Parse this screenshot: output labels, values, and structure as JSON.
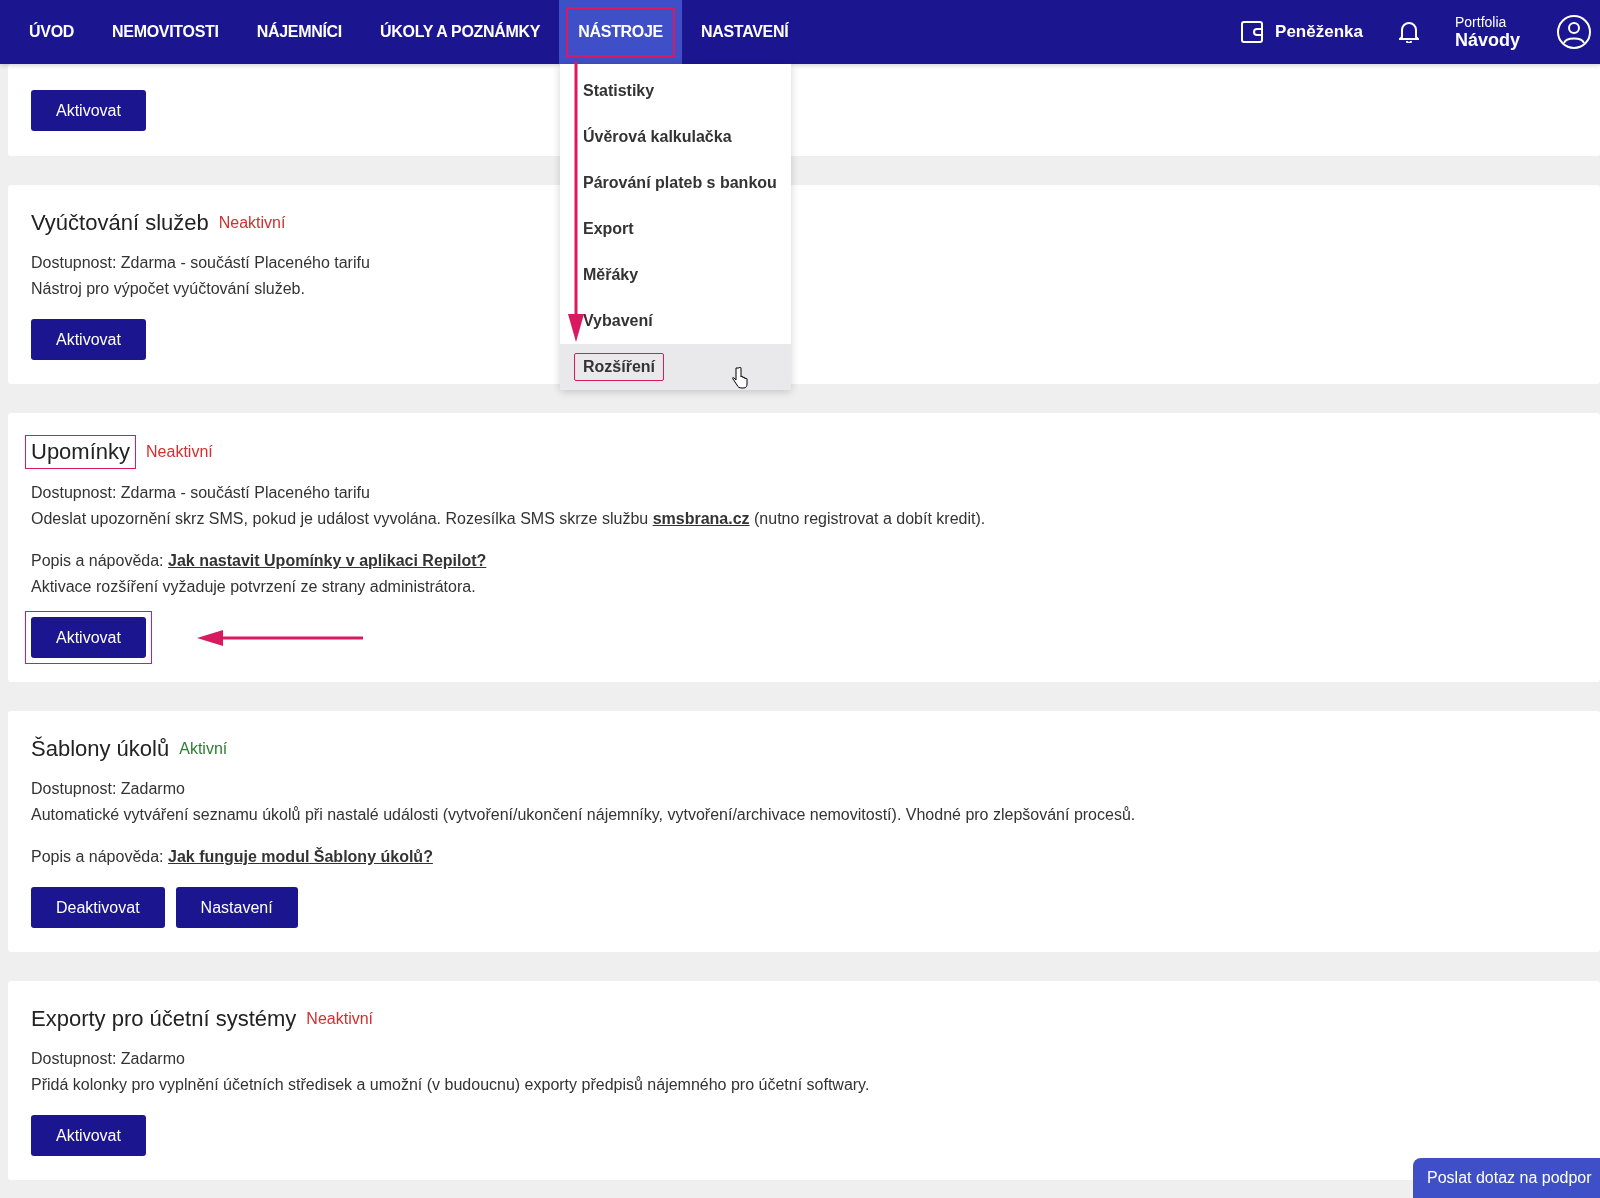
{
  "nav": {
    "items": [
      {
        "label": "ÚVOD",
        "selected": false,
        "annotated": false
      },
      {
        "label": "NEMOVITOSTI",
        "selected": false,
        "annotated": false
      },
      {
        "label": "NÁJEMNÍCI",
        "selected": false,
        "annotated": false
      },
      {
        "label": "ÚKOLY A POZNÁMKY",
        "selected": false,
        "annotated": false
      },
      {
        "label": "NÁSTROJE",
        "selected": true,
        "annotated": true
      },
      {
        "label": "NASTAVENÍ",
        "selected": false,
        "annotated": false
      }
    ],
    "wallet": "Peněženka",
    "portfolio_label": "Portfolia",
    "portfolio_name": "Návody"
  },
  "dropdown": {
    "items": [
      {
        "label": "Statistiky",
        "hovered": false,
        "annotated": false
      },
      {
        "label": "Úvěrová kalkulačka",
        "hovered": false,
        "annotated": false
      },
      {
        "label": "Párování plateb s bankou",
        "hovered": false,
        "annotated": false
      },
      {
        "label": "Export",
        "hovered": false,
        "annotated": false
      },
      {
        "label": "Měřáky",
        "hovered": false,
        "annotated": false
      },
      {
        "label": "Vybavení",
        "hovered": false,
        "annotated": false
      },
      {
        "label": "Rozšíření",
        "hovered": true,
        "annotated": true
      }
    ]
  },
  "modules": [
    {
      "buttons": [
        {
          "label": "Aktivovat",
          "annotated": false
        }
      ]
    },
    {
      "title": "Vyúčtování služeb",
      "title_annotated": false,
      "status": {
        "label": "Neaktivní",
        "kind": "inactive"
      },
      "availability": "Dostupnost: Zdarma - součástí Placeného tarifu",
      "description": {
        "text": "Nástroj pro výpočet vyúčtování služeb."
      },
      "buttons": [
        {
          "label": "Aktivovat",
          "annotated": false
        }
      ]
    },
    {
      "title": "Upomínky",
      "title_annotated": true,
      "status": {
        "label": "Neaktivní",
        "kind": "inactive"
      },
      "availability": "Dostupnost: Zdarma - součástí Placeného tarifu",
      "description": {
        "text": "Odeslat upozornění skrz SMS, pokud je událost vyvolána. Rozesílka SMS skrze službu ",
        "link": "smsbrana.cz",
        "after": " (nutno registrovat a dobít kredit)."
      },
      "help": {
        "label": "Popis a nápověda:",
        "link": "Jak nastavit Upomínky v aplikaci Repilot?"
      },
      "note": "Aktivace rozšíření vyžaduje potvrzení ze strany administrátora.",
      "buttons": [
        {
          "label": "Aktivovat",
          "annotated": true
        }
      ]
    },
    {
      "title": "Šablony úkolů",
      "title_annotated": false,
      "status": {
        "label": "Aktivní",
        "kind": "active"
      },
      "availability": "Dostupnost: Zadarmo",
      "description": {
        "text": "Automatické vytváření seznamu úkolů při nastalé události (vytvoření/ukončení nájemníky, vytvoření/archivace nemovitostí). Vhodné pro zlepšování procesů."
      },
      "help": {
        "label": "Popis a nápověda:",
        "link": "Jak funguje modul Šablony úkolů?"
      },
      "buttons": [
        {
          "label": "Deaktivovat",
          "annotated": false
        },
        {
          "label": "Nastavení",
          "annotated": false
        }
      ]
    },
    {
      "title": "Exporty pro účetní systémy",
      "title_annotated": false,
      "status": {
        "label": "Neaktivní",
        "kind": "inactive"
      },
      "availability": "Dostupnost: Zadarmo",
      "description": {
        "text": "Přidá kolonky pro vyplnění účetních středisek a umožní (v budoucnu) exporty předpisů nájemného pro účetní softwary."
      },
      "buttons": [
        {
          "label": "Aktivovat",
          "annotated": false
        }
      ]
    }
  ],
  "support_button": "Poslat dotaz na podpor"
}
